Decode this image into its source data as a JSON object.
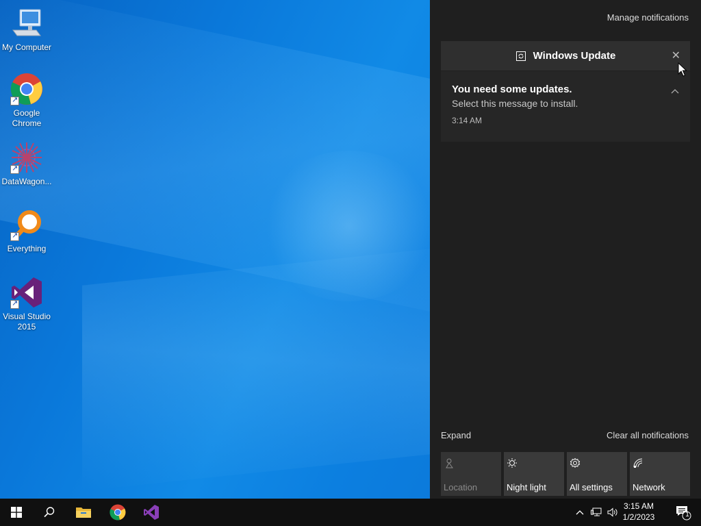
{
  "desktop": {
    "icons": [
      {
        "label": "My Computer",
        "icon": "monitor-icon"
      },
      {
        "label": "Google Chrome",
        "icon": "chrome-icon"
      },
      {
        "label": "DataWagon...",
        "icon": "datawagon-icon"
      },
      {
        "label": "Everything",
        "icon": "magnifier-icon"
      },
      {
        "label": "Visual Studio 2015",
        "icon": "visual-studio-icon"
      }
    ]
  },
  "action_center": {
    "manage_label": "Manage notifications",
    "notification": {
      "app_name": "Windows Update",
      "title": "You need some updates.",
      "message": "Select this message to install.",
      "time": "3:14 AM"
    },
    "expand_label": "Expand",
    "clear_all_label": "Clear all notifications",
    "quick_actions": [
      {
        "label": "Location",
        "icon": "location-icon",
        "enabled": false
      },
      {
        "label": "Night light",
        "icon": "night-light-icon",
        "enabled": true
      },
      {
        "label": "All settings",
        "icon": "gear-icon",
        "enabled": true
      },
      {
        "label": "Network",
        "icon": "network-icon",
        "enabled": true
      }
    ]
  },
  "taskbar": {
    "clock_time": "3:15 AM",
    "clock_date": "1/2/2023",
    "notification_count": "1",
    "pinned": [
      "start-button",
      "search-button",
      "file-explorer",
      "chrome",
      "visual-studio"
    ]
  },
  "colors": {
    "action_center_bg": "#1f1f1f",
    "taskbar_bg": "#101010",
    "wallpaper_blue": "#0a78da"
  }
}
